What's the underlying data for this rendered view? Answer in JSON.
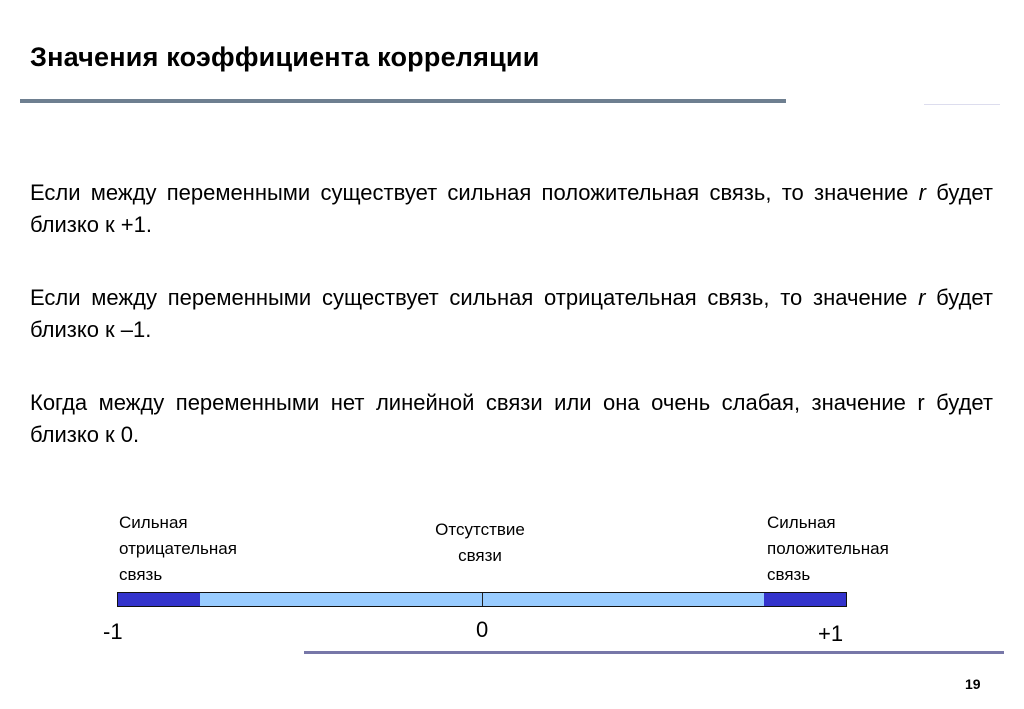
{
  "slide": {
    "title": "Значения коэффициента корреляции",
    "paragraphs": [
      {
        "before": "Если между переменными существует сильная положительная связь, то значение ",
        "var": "r",
        "after": " будет близко к   +1."
      },
      {
        "before": "Если между переменными существует сильная отрицательная связь, то значение ",
        "var": "r",
        "after": " будет близко к   –1."
      },
      {
        "before": "Когда между переменными нет линейной связи или она очень слабая, значение r будет близко к 0.",
        "var": "",
        "after": ""
      }
    ],
    "scale": {
      "labels": {
        "negative": [
          "Сильная",
          "отрицательная",
          "связь"
        ],
        "none": [
          "Отсутствие",
          "связи"
        ],
        "positive": [
          "Сильная",
          "положительная",
          "связь"
        ]
      },
      "ticks": {
        "min": "-1",
        "zero": "0",
        "max": "+1"
      },
      "colors": {
        "strong": "#3333cc",
        "weak": "#99ccff"
      }
    },
    "page_number": "19"
  }
}
